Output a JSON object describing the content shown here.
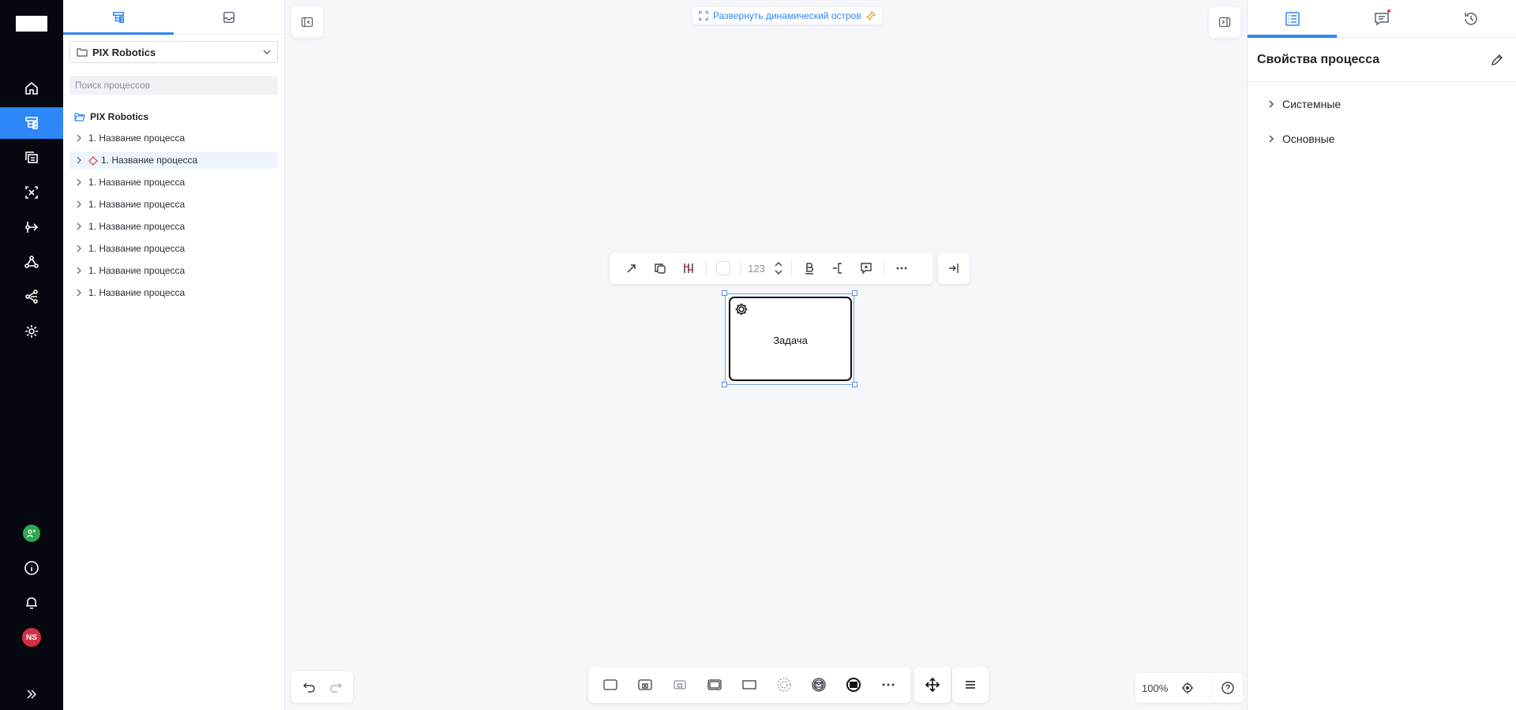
{
  "rail": {
    "items": [
      "home-icon",
      "process-tree-icon",
      "stack-icon",
      "scan-icon",
      "flow-icon",
      "network-icon",
      "share-icon",
      "gear-icon"
    ],
    "active_index": 1,
    "avatar_initials": "NS"
  },
  "tree": {
    "tabs": [
      "process-tree-icon",
      "inbox-icon"
    ],
    "project": "PIX Robotics",
    "search_placeholder": "Поиск процессов",
    "root_label": "PIX Robotics",
    "rows": [
      {
        "label": "1. Название процесса",
        "highlighted": false,
        "diamond": false
      },
      {
        "label": "1. Название процесса",
        "highlighted": true,
        "diamond": true
      },
      {
        "label": "1. Название процесса",
        "highlighted": false,
        "diamond": false
      },
      {
        "label": "1. Название процесса",
        "highlighted": false,
        "diamond": false
      },
      {
        "label": "1. Название процесса",
        "highlighted": false,
        "diamond": false
      },
      {
        "label": "1. Название процесса",
        "highlighted": false,
        "diamond": false
      },
      {
        "label": "1. Название процесса",
        "highlighted": false,
        "diamond": false
      },
      {
        "label": "1. Название процесса",
        "highlighted": false,
        "diamond": false
      }
    ]
  },
  "canvas": {
    "expand_label": "Развернуть динамический остров",
    "font_size_value": "123",
    "task_label": "Задача",
    "zoom": "100%"
  },
  "props": {
    "title": "Свойства процесса",
    "sections": [
      "Системные",
      "Основные"
    ]
  },
  "colors": {
    "accent": "#2f86f6",
    "rail_bg": "#06080f",
    "danger": "#e53946"
  }
}
